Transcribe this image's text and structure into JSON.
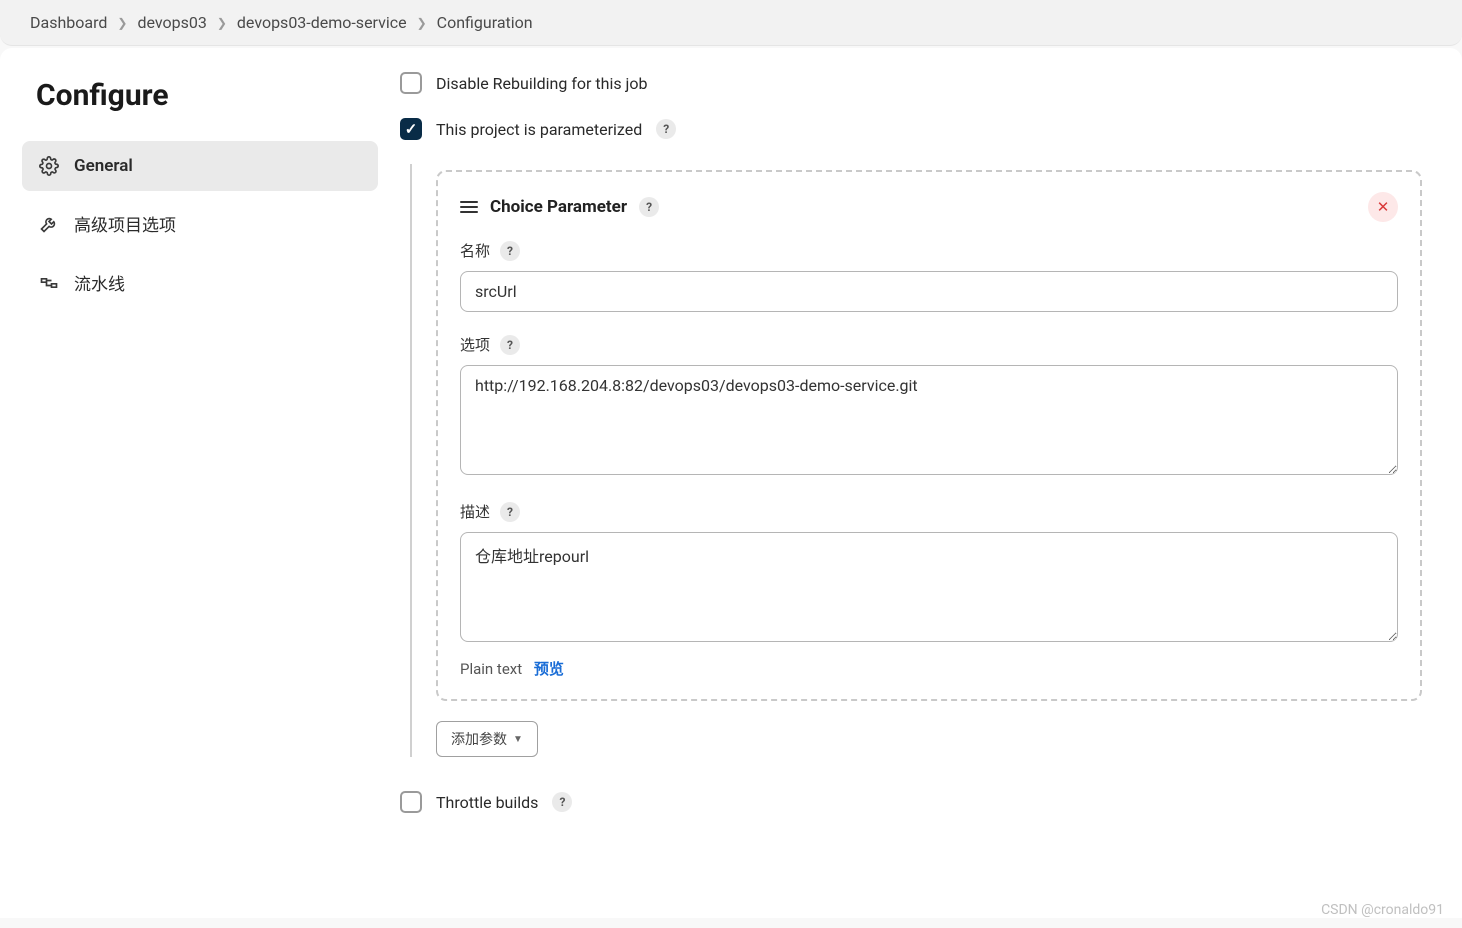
{
  "breadcrumb": [
    {
      "label": "Dashboard"
    },
    {
      "label": "devops03"
    },
    {
      "label": "devops03-demo-service"
    },
    {
      "label": "Configuration"
    }
  ],
  "page_title": "Configure",
  "sidebar": {
    "items": [
      {
        "label": "General",
        "icon": "gear-icon",
        "active": true
      },
      {
        "label": "高级项目选项",
        "icon": "wrench-icon",
        "active": false
      },
      {
        "label": "流水线",
        "icon": "pipeline-icon",
        "active": false
      }
    ]
  },
  "options": {
    "disable_rebuild": {
      "label": "Disable Rebuilding for this job",
      "checked": false
    },
    "parameterized": {
      "label": "This project is parameterized",
      "checked": true
    },
    "throttle": {
      "label": "Throttle builds",
      "checked": false
    }
  },
  "parameter_card": {
    "title": "Choice Parameter",
    "fields": {
      "name": {
        "label": "名称",
        "value": "srcUrl"
      },
      "choices": {
        "label": "选项",
        "value": "http://192.168.204.8:82/devops03/devops03-demo-service.git"
      },
      "description": {
        "label": "描述",
        "value": "仓库地址repourl"
      }
    },
    "format": {
      "plain_label": "Plain text",
      "preview_label": "预览"
    }
  },
  "add_param_label": "添加参数",
  "watermark": "CSDN @cronaldo91"
}
